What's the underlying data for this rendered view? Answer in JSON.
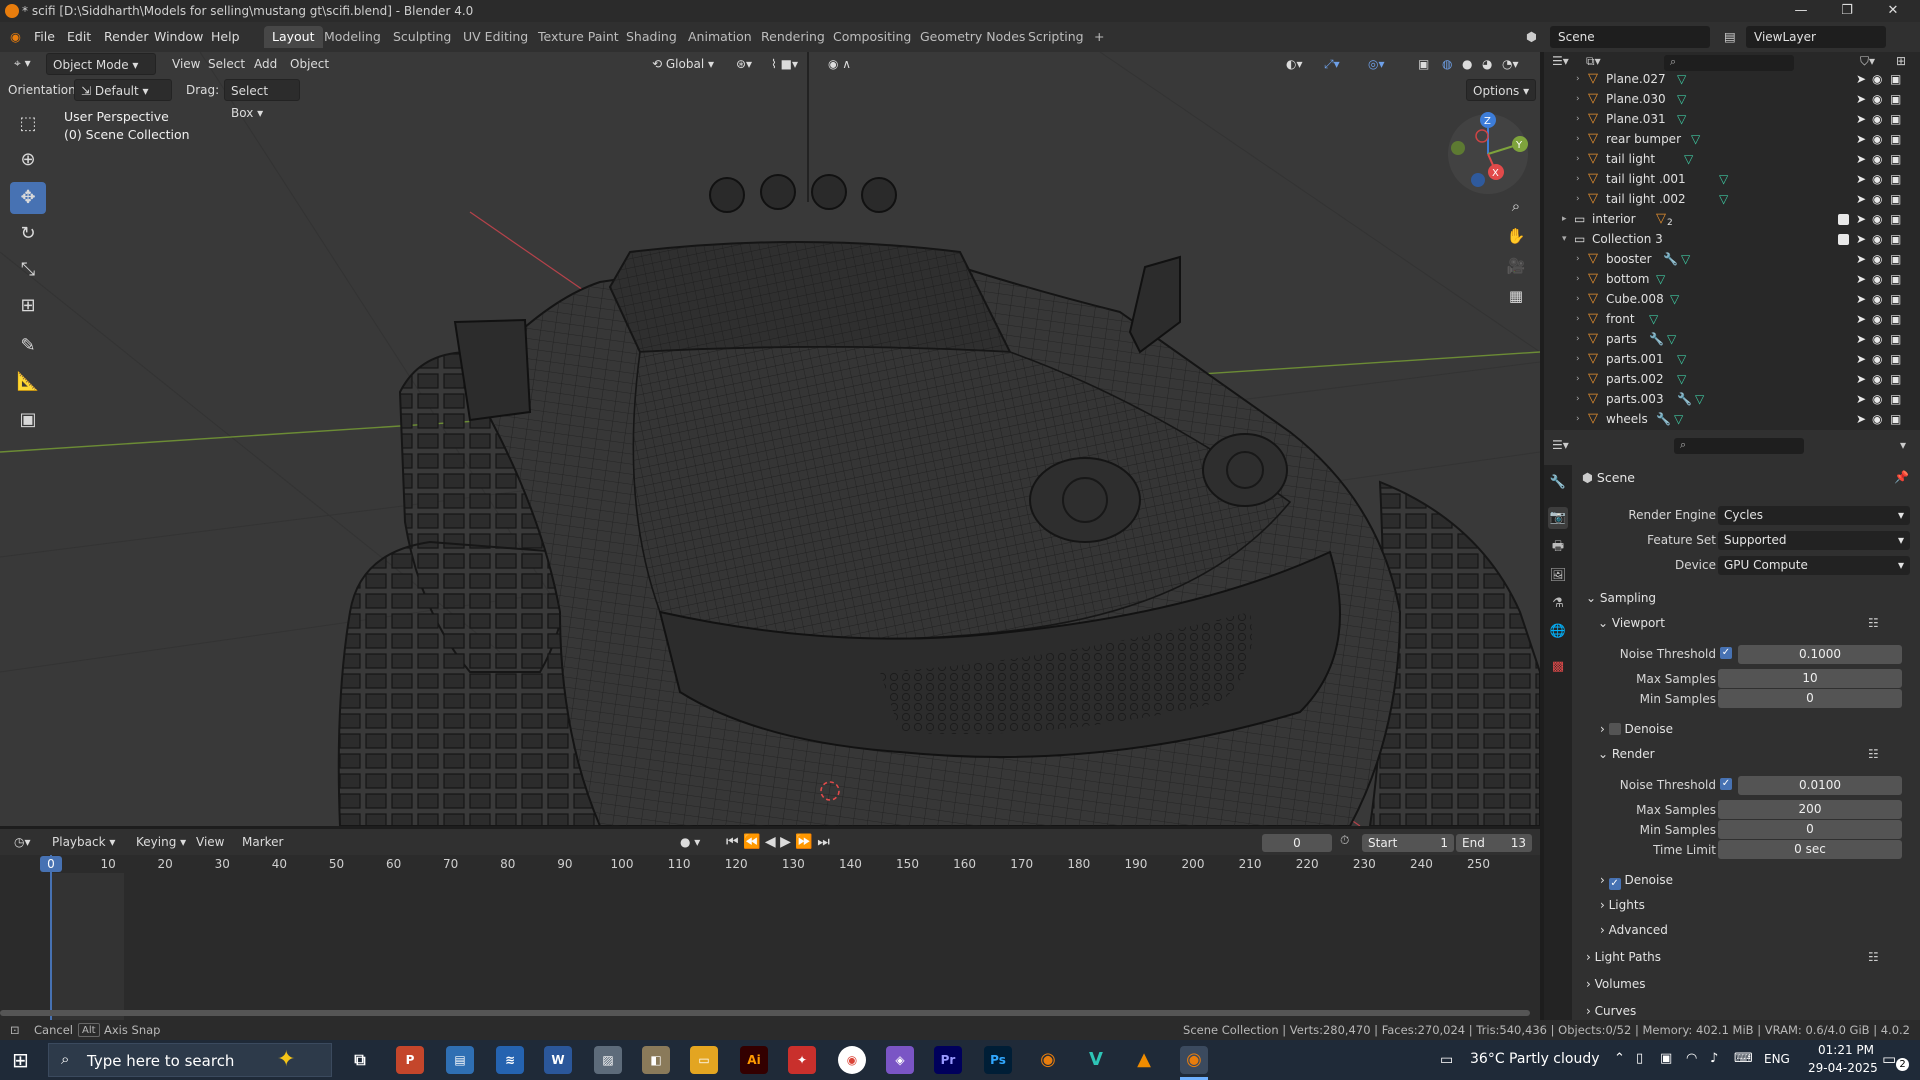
{
  "window": {
    "title": "* scifi [D:\\Siddharth\\Models for selling\\mustang gt\\scifi.blend] - Blender 4.0",
    "minimize": "—",
    "maximize": "❐",
    "close": "✕"
  },
  "menubar": {
    "menus": [
      "File",
      "Edit",
      "Render",
      "Window",
      "Help"
    ],
    "workspaces": [
      "Layout",
      "Modeling",
      "Sculpting",
      "UV Editing",
      "Texture Paint",
      "Shading",
      "Animation",
      "Rendering",
      "Compositing",
      "Geometry Nodes",
      "Scripting"
    ],
    "add_tab": "+",
    "scene": "Scene",
    "view_layer": "ViewLayer"
  },
  "viewport": {
    "mode": "Object Mode",
    "menus": [
      "View",
      "Select",
      "Add",
      "Object"
    ],
    "transform_orientation": "Global",
    "orientation_label": "Orientation:",
    "orientation_value": "Default",
    "drag_label": "Drag:",
    "drag_value": "Select Box",
    "options": "Options",
    "overlay_title": "User Perspective",
    "overlay_collection": "(0) Scene Collection",
    "gizmo": {
      "z": "Z",
      "y": "Y",
      "x": "X"
    }
  },
  "outliner": {
    "rows": [
      {
        "name": "Plane.027",
        "type": "mesh",
        "indent": 2
      },
      {
        "name": "Plane.030",
        "type": "mesh",
        "indent": 2
      },
      {
        "name": "Plane.031",
        "type": "mesh",
        "indent": 2
      },
      {
        "name": "rear bumper",
        "type": "mesh",
        "indent": 2
      },
      {
        "name": "tail light",
        "type": "mesh",
        "indent": 2
      },
      {
        "name": "tail light .001",
        "type": "mesh",
        "indent": 2
      },
      {
        "name": "tail light .002",
        "type": "mesh",
        "indent": 2
      },
      {
        "name": "interior",
        "type": "collection",
        "indent": 1,
        "badge": "2"
      },
      {
        "name": "Collection 3",
        "type": "collection",
        "indent": 1
      },
      {
        "name": "booster",
        "type": "mesh-mod",
        "indent": 2
      },
      {
        "name": "bottom",
        "type": "mesh",
        "indent": 2
      },
      {
        "name": "Cube.008",
        "type": "mesh",
        "indent": 2
      },
      {
        "name": "front",
        "type": "mesh",
        "indent": 2
      },
      {
        "name": "parts",
        "type": "mesh-mod",
        "indent": 2
      },
      {
        "name": "parts.001",
        "type": "mesh",
        "indent": 2
      },
      {
        "name": "parts.002",
        "type": "mesh",
        "indent": 2
      },
      {
        "name": "parts.003",
        "type": "mesh-mod",
        "indent": 2
      },
      {
        "name": "wheels",
        "type": "mesh-mod",
        "indent": 2
      }
    ]
  },
  "properties": {
    "context": "Scene",
    "render_engine_label": "Render Engine",
    "render_engine": "Cycles",
    "feature_set_label": "Feature Set",
    "feature_set": "Supported",
    "device_label": "Device",
    "device": "GPU Compute",
    "sampling": "Sampling",
    "viewport_panel": "Viewport",
    "noise_threshold_label": "Noise Threshold",
    "viewport_noise_threshold": "0.1000",
    "max_samples_label": "Max Samples",
    "viewport_max_samples": "10",
    "min_samples_label": "Min Samples",
    "viewport_min_samples": "0",
    "denoise_label": "Denoise",
    "render_panel": "Render",
    "render_noise_threshold": "0.0100",
    "render_max_samples": "200",
    "render_min_samples": "0",
    "time_limit_label": "Time Limit",
    "render_time_limit": "0 sec",
    "lights": "Lights",
    "advanced": "Advanced",
    "light_paths": "Light Paths",
    "volumes": "Volumes",
    "curves": "Curves"
  },
  "timeline": {
    "menus": [
      "Playback",
      "Keying",
      "View",
      "Marker"
    ],
    "current_frame": "0",
    "start_label": "Start",
    "start": "1",
    "end_label": "End",
    "end": "13",
    "ticks": [
      "0",
      "10",
      "20",
      "30",
      "40",
      "50",
      "60",
      "70",
      "80",
      "90",
      "100",
      "110",
      "120",
      "130",
      "140",
      "150",
      "160",
      "170",
      "180",
      "190",
      "200",
      "210",
      "220",
      "230",
      "240",
      "250"
    ]
  },
  "statusbar": {
    "cancel": "Cancel",
    "alt_key": "Alt",
    "axis_snap": "Axis Snap",
    "stats": "Scene Collection | Verts:280,470 | Faces:270,024 | Tris:540,436 | Objects:0/52 | Memory: 402.1 MiB | VRAM: 0.6/4.0 GiB | 4.0.2"
  },
  "taskbar": {
    "search_placeholder": "Type here to search",
    "weather": "36°C  Partly cloudy",
    "language": "ENG",
    "time": "01:21 PM",
    "date": "29-04-2025",
    "notifications": "2"
  },
  "colors": {
    "accent_blue": "#4772b3",
    "axis_red": "#e24a4a",
    "axis_green": "#7ea33c",
    "axis_blue": "#3d7dd9",
    "mesh_orange": "#e6902f",
    "data_green": "#3fc7a0"
  }
}
